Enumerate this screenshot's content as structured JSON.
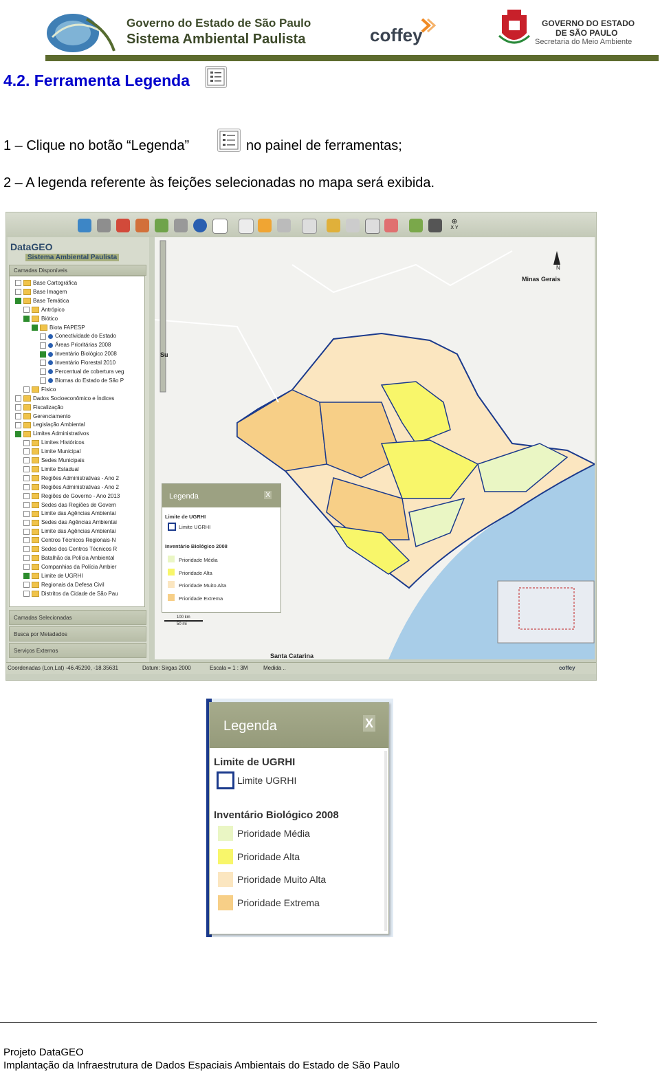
{
  "header": {
    "title_line1": "Governo do Estado de São Paulo",
    "title_line2": "Sistema Ambiental Paulista",
    "coffey_logo": "coffey",
    "gov_line1": "GOVERNO DO ESTADO",
    "gov_line2": "DE SÃO PAULO",
    "gov_line3": "Secretaria do Meio Ambiente",
    "bar_color": "#5d6b2e"
  },
  "doc": {
    "section_heading": "4.2. Ferramenta Legenda",
    "step1_before": "1 – Clique no botão “Legenda”",
    "step1_after": "no painel de ferramentas;",
    "step2": "2 – A legenda referente às feições selecionadas no mapa será exibida."
  },
  "app": {
    "logo": "DataGEO",
    "logo_sub": "Sistema Ambiental Paulista",
    "sidebar_header": "Camadas Disponíveis",
    "tree": [
      "Base Cartográfica",
      "Base Imagem",
      "Base Temática",
      "Antrópico",
      "Biótico",
      "Biota FAPESP",
      "Conectividade do Estado",
      "Áreas Prioritárias 2008",
      "Inventário Biológico 2008",
      "Inventário Florestal 2010",
      "Percentual de cobertura veg",
      "Biomas do Estado de São P",
      "Físico",
      "Dados Socioeconômico e Índices",
      "Fiscalização",
      "Gerenciamento",
      "Legislação Ambiental",
      "Limites Administrativos",
      "Limites Históricos",
      "Limite Municipal",
      "Sedes Municipais",
      "Limite Estadual",
      "Regiões Administrativas - Ano 2",
      "Regiões Administrativas - Ano 2",
      "Regiões de Governo - Ano 2013",
      "Sedes das Regiões de Govern",
      "Limite das Agências Ambientai",
      "Sedes das Agências Ambientai",
      "Limite das Agências Ambientai",
      "Centros Técnicos Regionais-N",
      "Sedes dos Centros Técnicos R",
      "Batalhão da Polícia Ambiental",
      "Companhias da Polícia Ambier",
      "Limite de UGRHI",
      "Regionais da Defesa Civil",
      "Distritos da Cidade de São Pau"
    ],
    "panel_selected": "Camadas Selecionadas",
    "panel_metadata": "Busca por Metadados",
    "panel_external": "Serviços Externos",
    "map_labels": {
      "minas_gerais": "Minas Gerais",
      "north": "N",
      "santa_catarina": "Santa Catarina",
      "sul": "Su",
      "scale_km": "100 km",
      "scale_mi": "50 mi",
      "xy": "X Y"
    },
    "status": {
      "coords": "Coordenadas (Lon,Lat) -46.45290, -18.35631",
      "datum": "Datum: Sirgas 2000",
      "scale": "Escala = 1 : 3M",
      "measure": "Medida ..",
      "coffey": "coffey"
    }
  },
  "legend": {
    "title": "Legenda",
    "close": "X",
    "section1": "Limite de UGRHI",
    "ugrhi_item": "Limite UGRHI",
    "section2": "Inventário Biológico 2008",
    "items": [
      {
        "label": "Prioridade Média",
        "color": "#eaf6c4"
      },
      {
        "label": "Prioridade Alta",
        "color": "#f8f66a"
      },
      {
        "label": "Prioridade Muito Alta",
        "color": "#fbe6c0"
      },
      {
        "label": "Prioridade Extrema",
        "color": "#f7cf87"
      }
    ],
    "ugrhi_color": "#1b3a8c"
  },
  "footer": {
    "line1": "Projeto DataGEO",
    "line2": "Implantação da Infraestrutura de Dados Espaciais Ambientais do Estado de São Paulo"
  }
}
